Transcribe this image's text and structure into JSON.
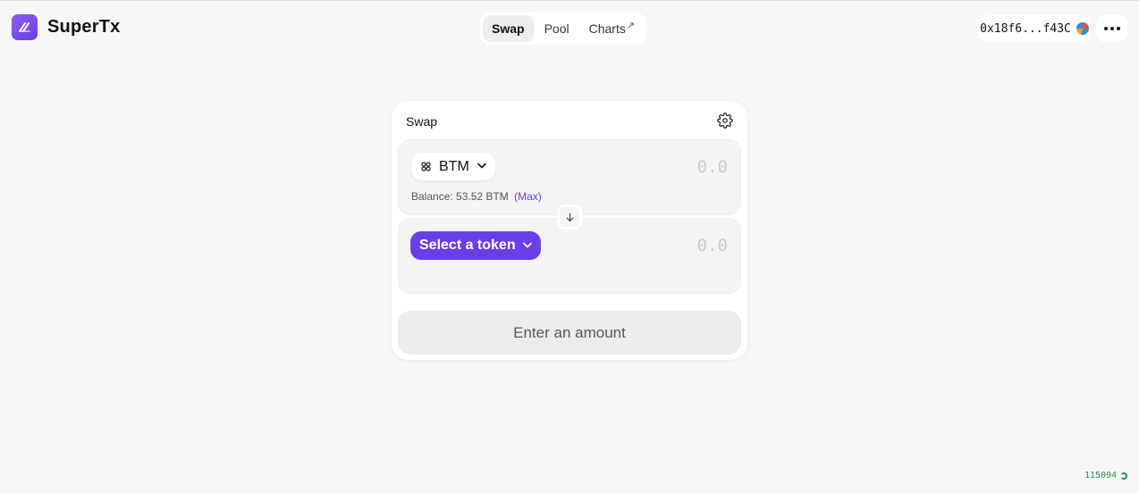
{
  "app": {
    "name": "SuperTx"
  },
  "nav": {
    "items": [
      {
        "label": "Swap"
      },
      {
        "label": "Pool"
      },
      {
        "label": "Charts"
      }
    ],
    "external_arrow": "↗"
  },
  "wallet": {
    "address": "0x18f6...f43C"
  },
  "swap": {
    "title": "Swap",
    "from": {
      "token_symbol": "BTM",
      "amount_placeholder": "0.0",
      "balance_label": "Balance: 53.52 BTM",
      "max_label": "(Max)"
    },
    "to": {
      "select_label": "Select a token",
      "amount_placeholder": "0.0"
    },
    "action_label": "Enter an amount"
  },
  "status": {
    "block_number": "115094"
  },
  "colors": {
    "accent": "#6b3fe8",
    "background": "#f7f7f9",
    "block_indicator": "#2f8f4a"
  },
  "icons": {
    "logo": "supertx-logo-icon",
    "settings": "gear-icon",
    "switch": "arrow-down-icon",
    "more": "more-horizontal-icon",
    "token": "btm-token-icon",
    "chevron": "chevron-down-icon"
  }
}
